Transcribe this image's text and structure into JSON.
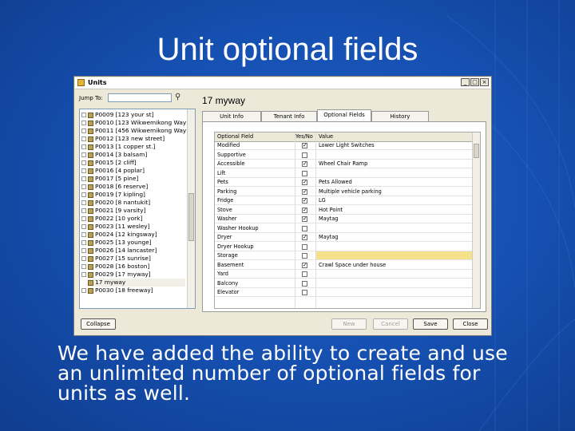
{
  "slide": {
    "title": "Unit optional fields",
    "body": "We have added the ability to create and use an unlimited number of optional fields for units as well."
  },
  "window": {
    "title": "Units",
    "controls": [
      "_",
      "□",
      "×"
    ],
    "jump_label": "Jump To:",
    "jump_value": "",
    "unit_heading": "17 myway",
    "tree": [
      {
        "label": "P0009 [123 your st]"
      },
      {
        "label": "P0010 [123 Wikwemikong Way]"
      },
      {
        "label": "P0011 [456 Wikwemikong Way]"
      },
      {
        "label": "P0012 [123 new street]"
      },
      {
        "label": "P0013 [1 copper st.]"
      },
      {
        "label": "P0014 [3 balsam]"
      },
      {
        "label": "P0015 [2 cliff]"
      },
      {
        "label": "P0016 [4 poplar]"
      },
      {
        "label": "P0017 [5 pine]"
      },
      {
        "label": "P0018 [6 reserve]"
      },
      {
        "label": "P0019 [7 kipling]"
      },
      {
        "label": "P0020 [8 nantukit]"
      },
      {
        "label": "P0021 [9 varsity]"
      },
      {
        "label": "P0022 [10 york]"
      },
      {
        "label": "P0023 [11 wesley]"
      },
      {
        "label": "P0024 [12 kingsway]"
      },
      {
        "label": "P0025 [13 younge]"
      },
      {
        "label": "P0026 [14 lancaster]"
      },
      {
        "label": "P0027 [15 sunrise]"
      },
      {
        "label": "P0028 [16 boston]"
      },
      {
        "label": "P0029 [17 myway]"
      },
      {
        "label": "17 myway"
      },
      {
        "label": "P0030 [18 freeway]"
      }
    ],
    "tabs": [
      "Unit Info",
      "Tenant Info",
      "Optional Fields",
      "History"
    ],
    "active_tab": "Optional Fields",
    "grid": {
      "headers": [
        "Optional Field",
        "Yes/No",
        "Value"
      ],
      "rows": [
        {
          "field": "Modified",
          "checked": true,
          "value": "Lower Light Switches"
        },
        {
          "field": "Supportive",
          "checked": false,
          "value": ""
        },
        {
          "field": "Accessible",
          "checked": true,
          "value": "Wheel Chair Ramp"
        },
        {
          "field": "Lift",
          "checked": false,
          "value": ""
        },
        {
          "field": "Pets",
          "checked": true,
          "value": "Pets Allowed"
        },
        {
          "field": "Parking",
          "checked": true,
          "value": "Multiple vehicle parking"
        },
        {
          "field": "Fridge",
          "checked": true,
          "value": "LG"
        },
        {
          "field": "Stove",
          "checked": true,
          "value": "Hot Point"
        },
        {
          "field": "Washer",
          "checked": true,
          "value": "Maytag"
        },
        {
          "field": "Washer Hookup",
          "checked": false,
          "value": ""
        },
        {
          "field": "Dryer",
          "checked": true,
          "value": "Maytag"
        },
        {
          "field": "Dryer Hookup",
          "checked": false,
          "value": ""
        },
        {
          "field": "Storage",
          "checked": false,
          "value": ""
        },
        {
          "field": "Basement",
          "checked": true,
          "value": "Crawl Space under house"
        },
        {
          "field": "Yard",
          "checked": false,
          "value": ""
        },
        {
          "field": "Balcony",
          "checked": false,
          "value": ""
        },
        {
          "field": "Elevator",
          "checked": false,
          "value": ""
        }
      ]
    },
    "buttons": {
      "collapse": "Collapse",
      "new": "New",
      "cancel": "Cancel",
      "save": "Save",
      "close": "Close"
    },
    "highlight_color": "#f6e08a"
  }
}
